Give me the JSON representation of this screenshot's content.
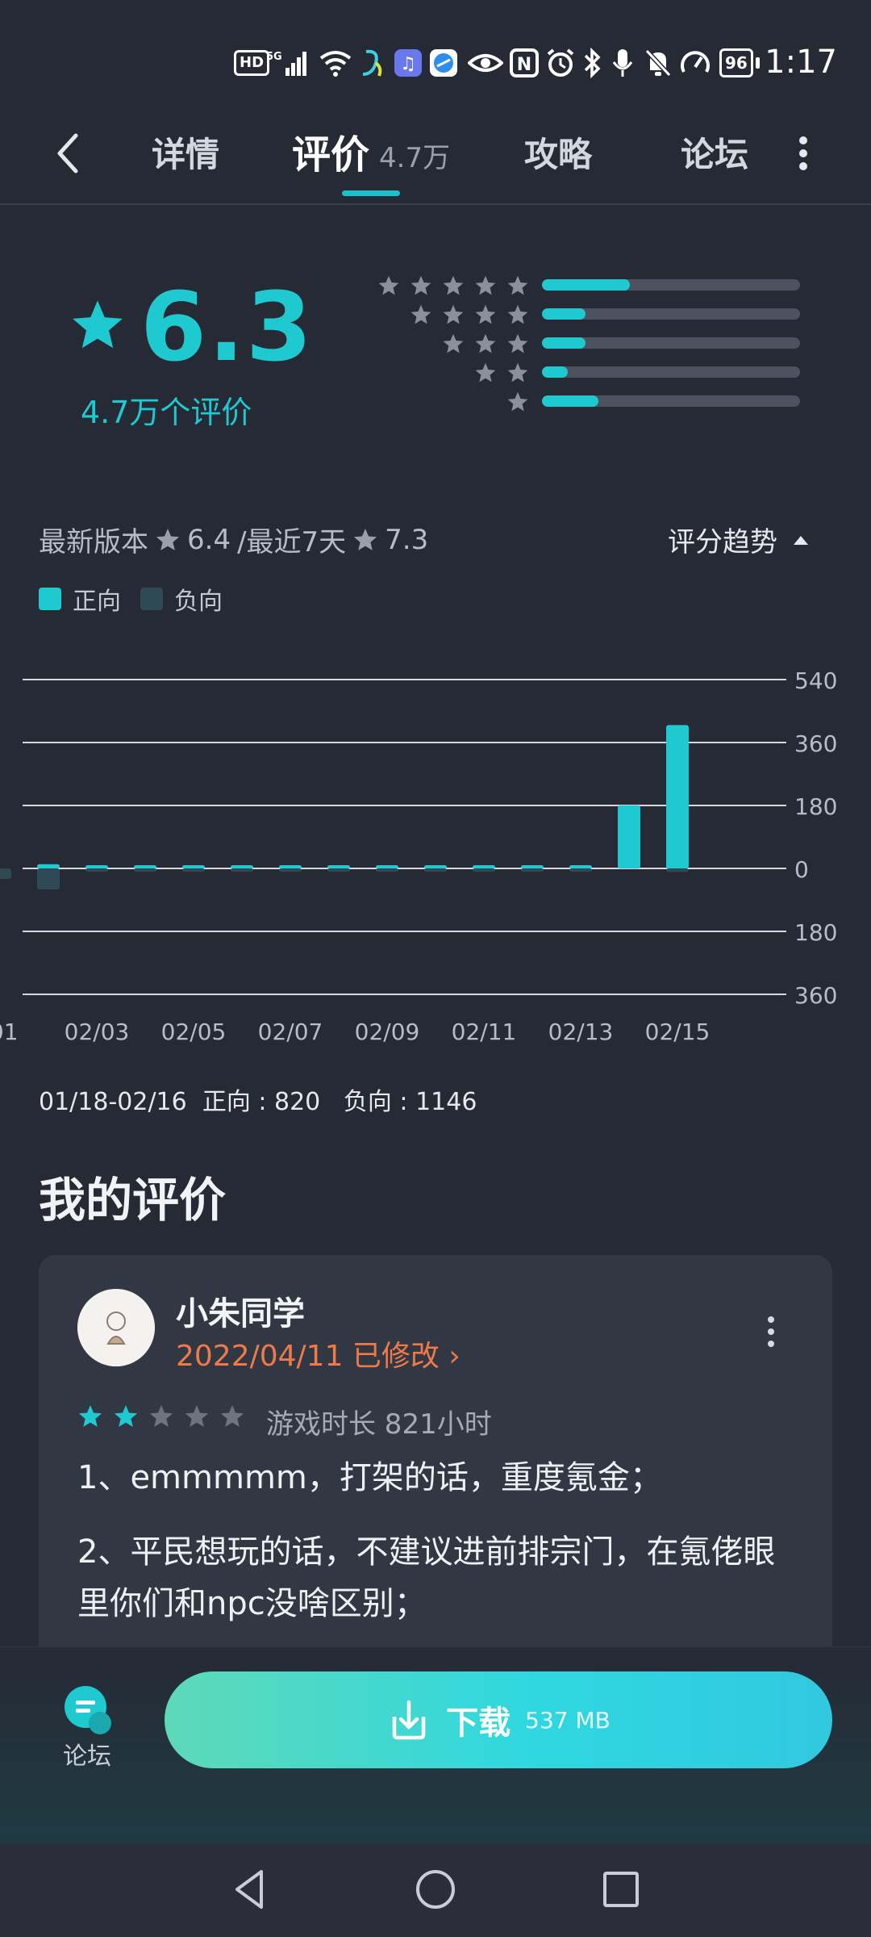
{
  "status_bar": {
    "time": "1:17",
    "battery": "96",
    "hd": "HD",
    "network": "5G",
    "icons": [
      "wifi-icon",
      "app-icon",
      "music-icon",
      "browser-icon",
      "eye-icon",
      "nfc-icon",
      "alarm-icon",
      "bluetooth-icon",
      "mic-icon",
      "mute-icon",
      "speed-icon",
      "battery-icon"
    ]
  },
  "nav": {
    "tabs": [
      "详情",
      "评价",
      "攻略",
      "论坛"
    ],
    "active": "评价",
    "reviews_count": "4.7万"
  },
  "rating": {
    "score": "6.3",
    "count_text": "4.7万个评价",
    "distribution": [
      {
        "stars": 5,
        "fraction": 0.34
      },
      {
        "stars": 4,
        "fraction": 0.17
      },
      {
        "stars": 3,
        "fraction": 0.17
      },
      {
        "stars": 2,
        "fraction": 0.1
      },
      {
        "stars": 1,
        "fraction": 0.22
      }
    ],
    "accent_color": "#1ec9cf"
  },
  "version": {
    "latest_label": "最新版本",
    "latest_score": "6.4",
    "recent_label": "/最近7天",
    "recent_score": "7.3",
    "trend_label": "评分趋势"
  },
  "legend": {
    "positive": "正向",
    "negative": "负向",
    "positive_color": "#1ec9cf",
    "negative_color": "#2f4a55"
  },
  "chart_data": {
    "type": "bar",
    "x": [
      "02/01",
      "02/02",
      "02/03",
      "02/04",
      "02/05",
      "02/06",
      "02/07",
      "02/08",
      "02/09",
      "02/10",
      "02/11",
      "02/12",
      "02/13",
      "02/14",
      "02/15",
      "02/16"
    ],
    "tick_labels": [
      "/01",
      "02/03",
      "02/05",
      "02/07",
      "02/09",
      "02/11",
      "02/13",
      "02/15"
    ],
    "series": [
      {
        "name": "正向",
        "values": [
          0,
          12,
          5,
          6,
          5,
          6,
          5,
          6,
          5,
          5,
          5,
          6,
          5,
          180,
          410,
          0
        ]
      },
      {
        "name": "负向",
        "values": [
          30,
          60,
          5,
          5,
          5,
          5,
          5,
          5,
          5,
          5,
          5,
          5,
          5,
          0,
          10,
          0
        ]
      }
    ],
    "y_ticks_positive": [
      540,
      360,
      180,
      0
    ],
    "y_ticks_negative": [
      180,
      360
    ],
    "ylim": [
      -360,
      540
    ],
    "grid": true
  },
  "stats": {
    "range": "01/18-02/16",
    "positive_label": "正向 : 820",
    "negative_label": "负向 : 1146"
  },
  "my_review": {
    "section_title": "我的评价",
    "user": "小朱同学",
    "date": "2022/04/11 已修改 ›",
    "stars": 2,
    "max_stars": 5,
    "playtime": "游戏时长 821小时",
    "paragraphs": [
      "1、emmmmm，打架的话，重度氪金；",
      "2、平民想玩的话，不建议进前排宗门，在氪佬眼里你们和npc没啥区别；"
    ]
  },
  "bottom": {
    "forum_label": "论坛",
    "download_label": "下载",
    "download_size": "537 MB"
  }
}
